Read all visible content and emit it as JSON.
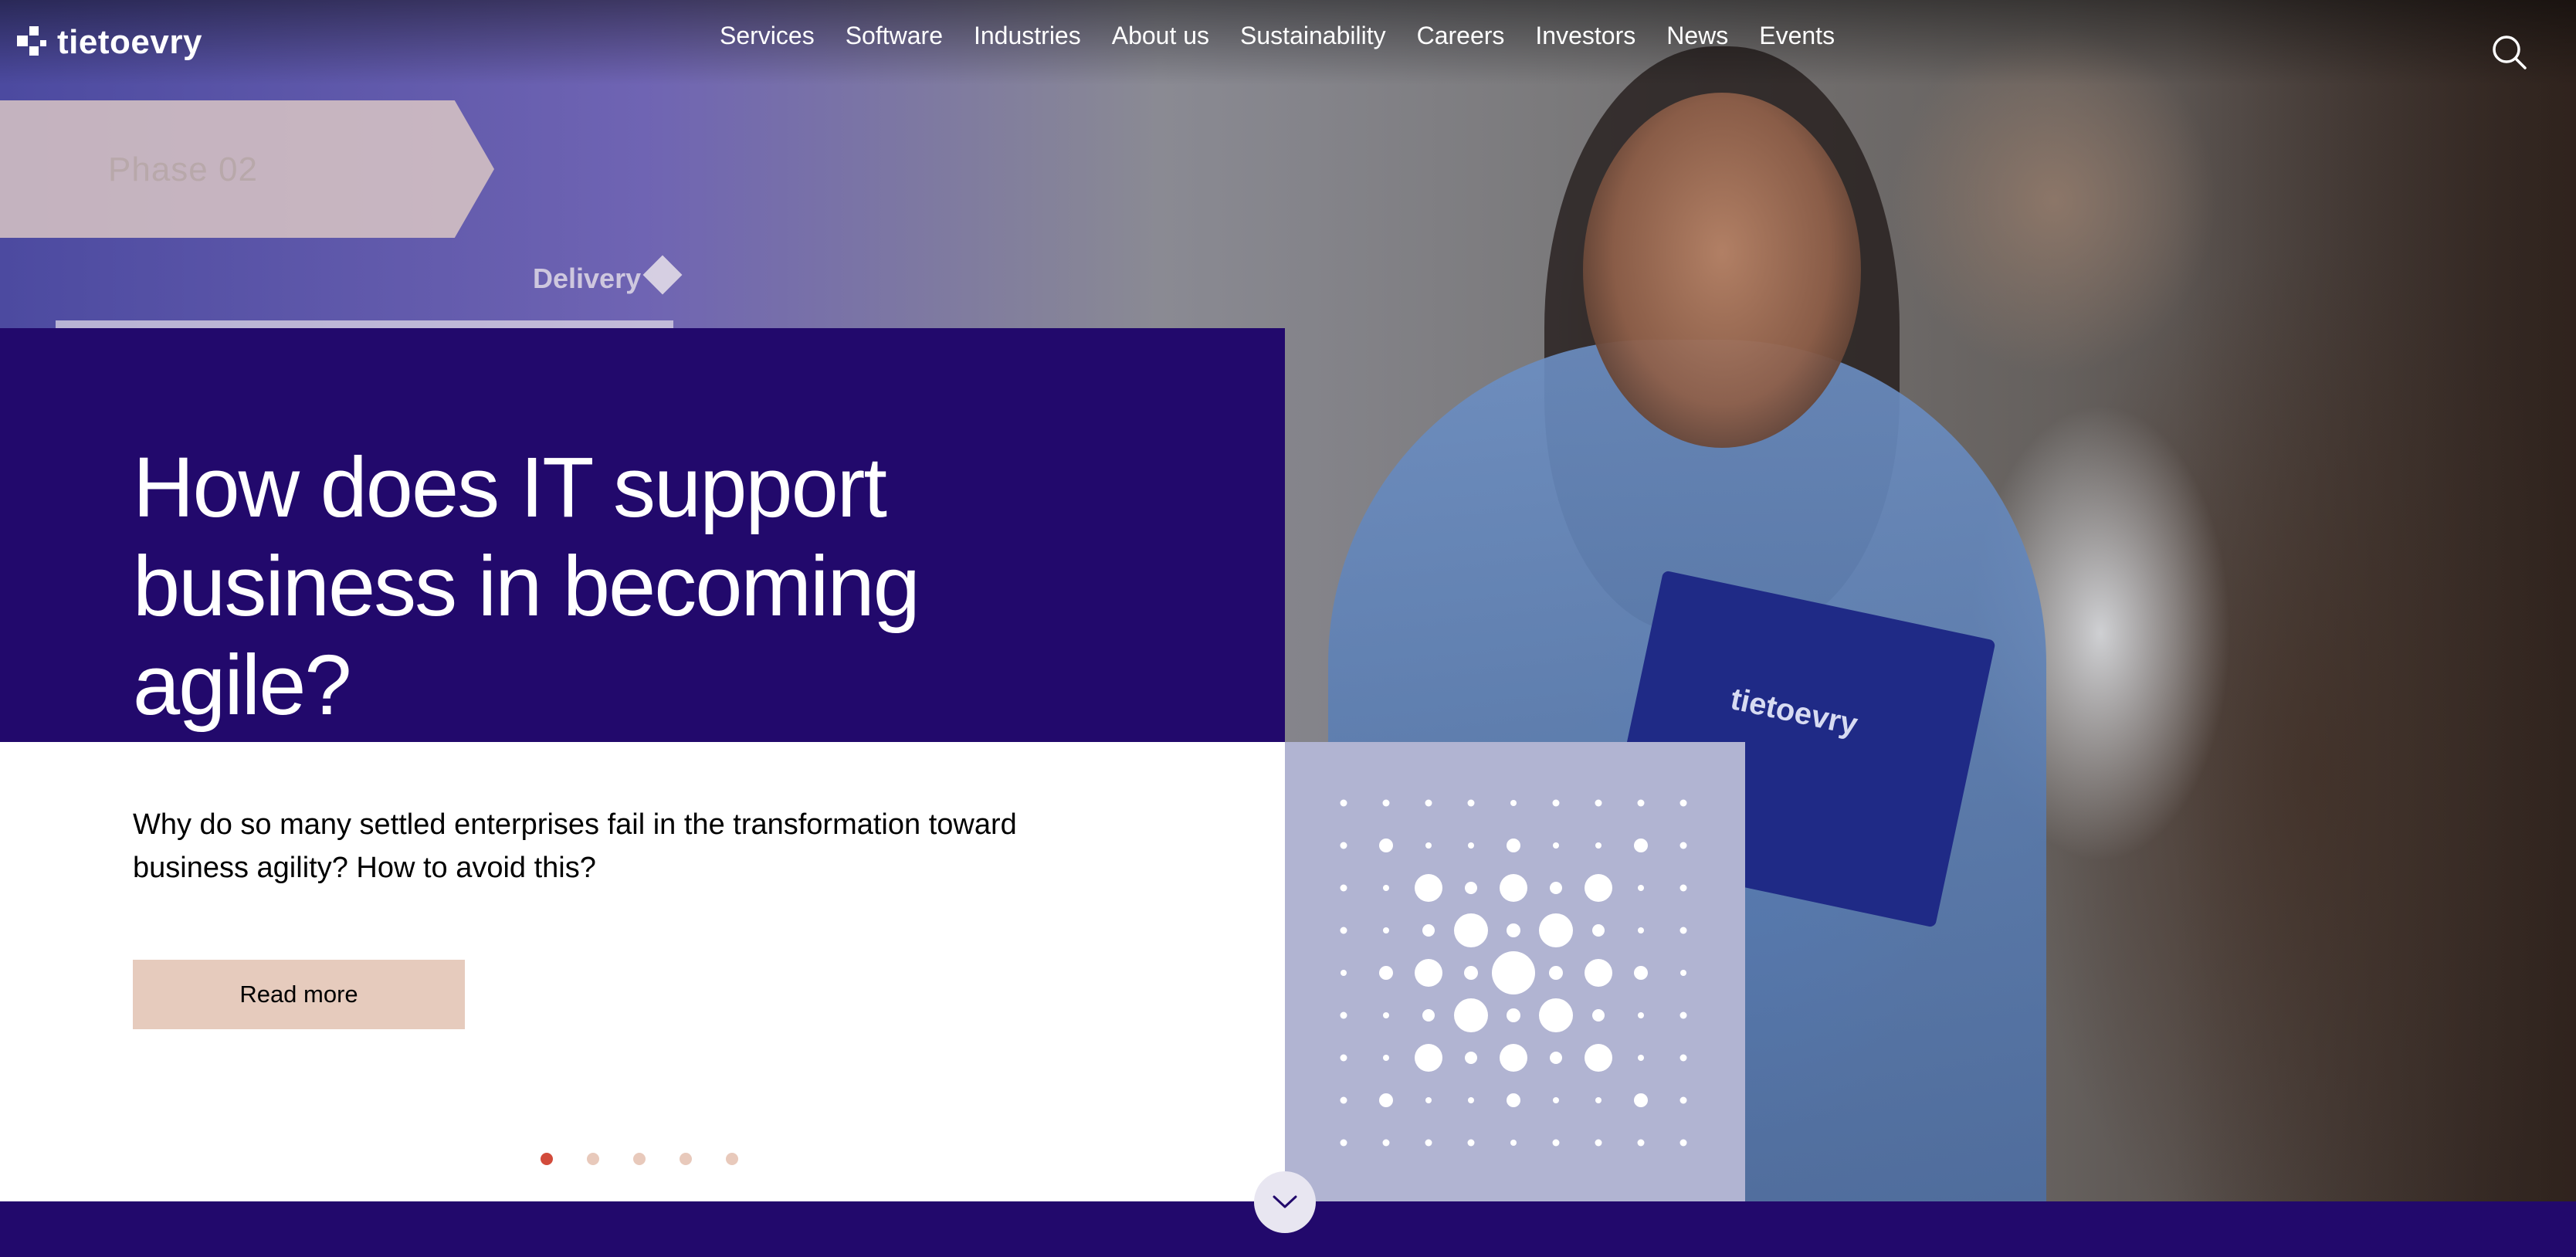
{
  "header": {
    "logo_text": "tietoevry",
    "nav": [
      "Services",
      "Software",
      "Industries",
      "About us",
      "Sustainability",
      "Careers",
      "Investors",
      "News",
      "Events"
    ],
    "search_icon": "search-icon"
  },
  "hero_background": {
    "board_phase_text": "Phase 02",
    "board_delivery_text": "Delivery",
    "folder_logo_text": "tietoevry"
  },
  "hero": {
    "title": "How does IT support business in becoming agile?",
    "description": "Why do so many settled enterprises fail in the transformation toward business agility? How to avoid this?",
    "cta_label": "Read more"
  },
  "carousel": {
    "slide_count": 5,
    "active_index": 0
  },
  "scroll_down_icon": "chevron-down-icon",
  "colors": {
    "brand_dark": "#22096c",
    "cta_bg": "#e6cbbd",
    "dot_active": "#d24b3b",
    "dot_inactive": "#e8c9bb",
    "graphic_bg": "#b1b4d2"
  }
}
